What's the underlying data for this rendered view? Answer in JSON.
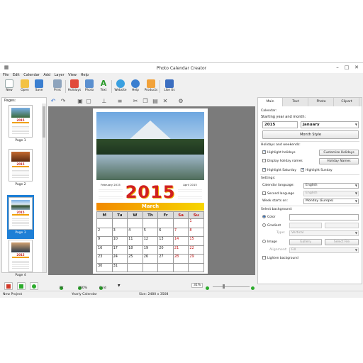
{
  "window": {
    "title": "Photo Calendar Creator",
    "min_glyph": "–",
    "max_glyph": "□",
    "close_glyph": "✕"
  },
  "menu": [
    "File",
    "Edit",
    "Calendar",
    "Add",
    "Layer",
    "View",
    "Help"
  ],
  "toolbar": {
    "new": "New",
    "open": "Open",
    "save": "Save",
    "print": "Print",
    "holidays": "Holidays",
    "photo": "Photo",
    "text": "Text",
    "website": "Website",
    "help": "Help",
    "products": "Products",
    "like_us": "Like Us"
  },
  "pages_panel": {
    "header": "Pages:",
    "items": [
      {
        "label": "Page 1",
        "year": "2015"
      },
      {
        "label": "Page 2",
        "year": "2015"
      },
      {
        "label": "Page 3",
        "year": "2015"
      },
      {
        "label": "Page 4",
        "year": "2015"
      }
    ],
    "selected_index": 2
  },
  "calendar_page": {
    "year": "2015",
    "month": "March",
    "mini_left": {
      "title": "February",
      "year": "2015"
    },
    "mini_right": {
      "title": "April",
      "year": "2015"
    },
    "weekdays": [
      "M",
      "Tu",
      "W",
      "Th",
      "Fr",
      "Sa",
      "Su"
    ],
    "weeks": [
      [
        "",
        "",
        "",
        "",
        "",
        "",
        "1"
      ],
      [
        "2",
        "3",
        "4",
        "5",
        "6",
        "7",
        "8"
      ],
      [
        "9",
        "10",
        "11",
        "12",
        "13",
        "14",
        "15"
      ],
      [
        "16",
        "17",
        "18",
        "19",
        "20",
        "21",
        "22"
      ],
      [
        "23",
        "24",
        "25",
        "26",
        "27",
        "28",
        "29"
      ],
      [
        "30",
        "31",
        "",
        "",
        "",
        "",
        ""
      ]
    ]
  },
  "right_panel": {
    "tabs": [
      "Main",
      "Text",
      "Photo",
      "Clipart"
    ],
    "active_tab": "Main",
    "calendar_label": "Calendar:",
    "start_label": "Starting year and month:",
    "start_year": "2015",
    "start_month": "January",
    "month_style_btn": "Month Style",
    "holidays_label": "Holidays and weekends:",
    "highlight_holidays": "Highlight holidays",
    "customize_holidays_btn": "Customize Holidays",
    "display_holiday_names": "Display holiday names",
    "holiday_names_btn": "Holiday Names",
    "highlight_saturday": "Highlight Saturday",
    "highlight_sunday": "Highlight Sunday",
    "settings_label": "Settings:",
    "calendar_language_label": "Calendar language:",
    "calendar_language": "English",
    "second_language_label": "Second language",
    "second_language": "English",
    "week_starts_label": "Week starts on:",
    "week_starts": "Monday (Europe)",
    "background_label": "Select background:",
    "color_label": "Color",
    "gradient_label": "Gradient",
    "type_label": "Type:",
    "type_value": "Vertical",
    "image_label": "Image",
    "gallery_btn": "Gallery",
    "select_file_btn": "Select File",
    "alignment_label": "Alignment:",
    "alignment_value": "Fill",
    "lighten_label": "Lighten background"
  },
  "status": {
    "fit": "Fit",
    "zoom100": "100%",
    "grid": "Grid",
    "zoom": "31%"
  },
  "bottom": {
    "project": "New Project",
    "type": "Yearly Calendar",
    "size": "Size: 2480 x 3508"
  },
  "colors": {
    "year": "#d12020",
    "month_bar_start": "#f28a00",
    "month_bar_end": "#f7d600",
    "selection": "#1e7fd6",
    "canvas_bg": "#7b7b7b"
  }
}
